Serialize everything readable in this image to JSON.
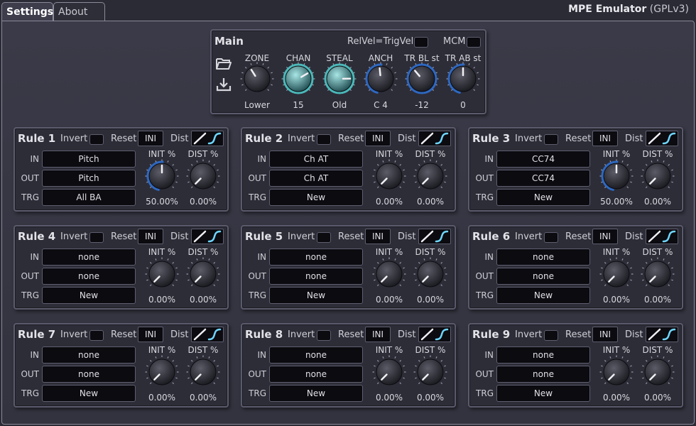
{
  "tabs": [
    {
      "label": "Settings"
    },
    {
      "label": "About"
    }
  ],
  "app": {
    "name": "MPE Emulator",
    "license": "(GPLv3)"
  },
  "main": {
    "title": "Main",
    "relvel_label": "RelVel=TrigVel",
    "relvel_checked": false,
    "mcm_label": "MCM",
    "mcm_checked": false,
    "knobs": [
      {
        "label": "ZONE",
        "value": "Lower",
        "level": 0.38,
        "accent": "none"
      },
      {
        "label": "CHAN",
        "value": "15",
        "level": 0.72,
        "accent": "teal"
      },
      {
        "label": "STEAL",
        "value": "Old",
        "level": 0.83,
        "accent": "teal"
      },
      {
        "label": "ANCH",
        "value": "C 4",
        "level": 0.48,
        "accent": "blue"
      },
      {
        "label": "TR BL st",
        "value": "-12",
        "level": 0.35,
        "accent": "blue-left"
      },
      {
        "label": "TR AB st",
        "value": "0",
        "level": 0.5,
        "accent": "blue"
      }
    ]
  },
  "rule_labels": {
    "invert": "Invert",
    "reset": "Reset",
    "ini": "INI",
    "dist": "Dist",
    "in": "IN",
    "out": "OUT",
    "trg": "TRG",
    "init_pct": "INIT %",
    "dist_pct": "DIST %"
  },
  "rules": [
    {
      "title": "Rule 1",
      "in": "Pitch",
      "out": "Pitch",
      "trg": "All BA",
      "init": "50.00%",
      "init_level": 0.5,
      "dist": "0.00%",
      "dist_level": 0.0
    },
    {
      "title": "Rule 2",
      "in": "Ch AT",
      "out": "Ch AT",
      "trg": "New",
      "init": "0.00%",
      "init_level": 0.0,
      "dist": "0.00%",
      "dist_level": 0.0
    },
    {
      "title": "Rule 3",
      "in": "CC74",
      "out": "CC74",
      "trg": "New",
      "init": "50.00%",
      "init_level": 0.5,
      "dist": "0.00%",
      "dist_level": 0.0
    },
    {
      "title": "Rule 4",
      "in": "none",
      "out": "none",
      "trg": "New",
      "init": "0.00%",
      "init_level": 0.0,
      "dist": "0.00%",
      "dist_level": 0.0
    },
    {
      "title": "Rule 5",
      "in": "none",
      "out": "none",
      "trg": "New",
      "init": "0.00%",
      "init_level": 0.0,
      "dist": "0.00%",
      "dist_level": 0.0
    },
    {
      "title": "Rule 6",
      "in": "none",
      "out": "none",
      "trg": "New",
      "init": "0.00%",
      "init_level": 0.0,
      "dist": "0.00%",
      "dist_level": 0.0
    },
    {
      "title": "Rule 7",
      "in": "none",
      "out": "none",
      "trg": "New",
      "init": "0.00%",
      "init_level": 0.0,
      "dist": "0.00%",
      "dist_level": 0.0
    },
    {
      "title": "Rule 8",
      "in": "none",
      "out": "none",
      "trg": "New",
      "init": "0.00%",
      "init_level": 0.0,
      "dist": "0.00%",
      "dist_level": 0.0
    },
    {
      "title": "Rule 9",
      "in": "none",
      "out": "none",
      "trg": "New",
      "init": "0.00%",
      "init_level": 0.0,
      "dist": "0.00%",
      "dist_level": 0.0
    }
  ],
  "colors": {
    "accent_blue": "#2f6fd0",
    "accent_teal": "#4fc8c8",
    "panel_bg": "#2d2d38",
    "field_bg": "#0b0b10"
  },
  "icons": {
    "open": "folder-open-icon",
    "save": "download-icon",
    "curve_linear": "linear-curve-icon",
    "curve_s": "s-curve-icon"
  }
}
